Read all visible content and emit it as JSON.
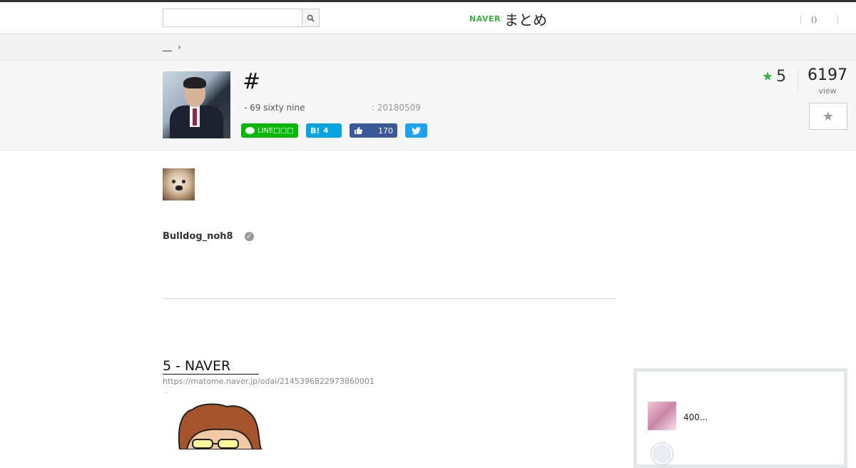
{
  "header": {
    "search_placeholder": "",
    "logo_brand": "NAVER",
    "logo_name": "まとめ",
    "user_label": "()"
  },
  "breadcrumb": {
    "item": "__"
  },
  "article": {
    "title": "#",
    "author": "- 69 sixty nine",
    "date": ": 20180509",
    "share": {
      "line_label": "LINE□□□",
      "hatena_label": "B!",
      "hatena_count": "4",
      "facebook_count": "170"
    },
    "favorites": "5",
    "views": "6197",
    "views_label": "view"
  },
  "curator": {
    "name": "Bulldog_noh8"
  },
  "link_card": {
    "title": "5 - NAVER",
    "url": "https://matome.naver.jp/odai/2145396822973860001",
    "dash": "-"
  },
  "sidebar": {
    "item_text": "400..."
  },
  "colors": {
    "accent_green": "#3cb043",
    "line_green": "#00b900",
    "hatena_blue": "#00a4de",
    "facebook_blue": "#3b5998",
    "twitter_blue": "#1da1f2"
  }
}
